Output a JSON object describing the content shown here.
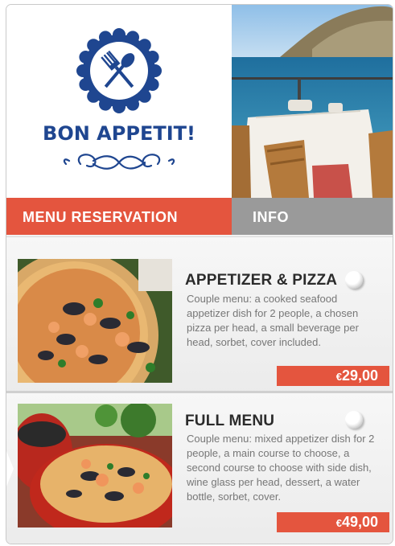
{
  "brand": {
    "logo_text": "BON APPETIT!",
    "color": "#1f4690"
  },
  "tabs": [
    {
      "label": "MENU RESERVATION",
      "active": true,
      "color": "#e4553e"
    },
    {
      "label": "INFO",
      "active": false,
      "color": "#9a9a9a"
    }
  ],
  "menu_items": [
    {
      "title": "APPETIZER & PIZZA",
      "description": "Couple menu: a cooked seafood appetizer dish for 2 people, a chosen pizza per head, a small beverage per head, sorbet, cover included.",
      "currency": "€",
      "price": "29,00",
      "selected": false
    },
    {
      "title": "FULL MENU",
      "description": "Couple menu: mixed appetizer dish for 2 people, a main course to choose, a second course to choose with side dish, wine glass per head, dessert, a water bottle, sorbet, cover.",
      "currency": "€",
      "price": "49,00",
      "selected": false
    }
  ],
  "icons": [
    "fork-spoon-icon",
    "flourish-ornament"
  ]
}
